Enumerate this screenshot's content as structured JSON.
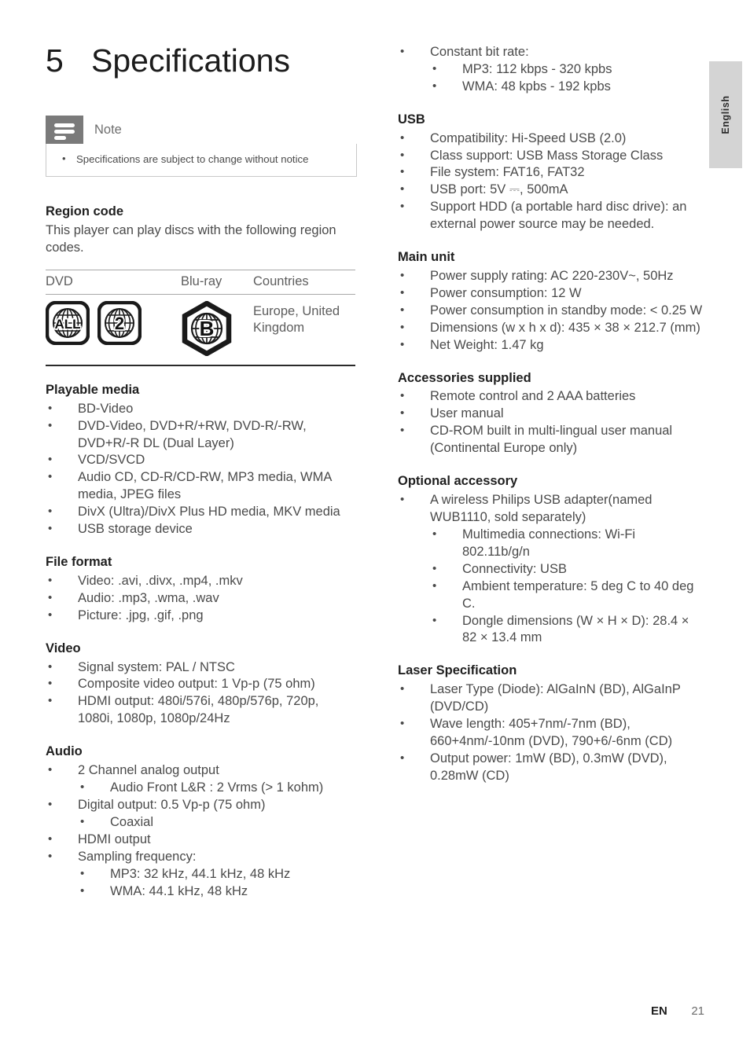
{
  "language_tab": {
    "label": "English"
  },
  "chapter": {
    "number": "5",
    "title": "Specifications"
  },
  "note": {
    "icon": "note-lines-icon",
    "title": "Note",
    "items": [
      "Specifications are subject to change without notice"
    ]
  },
  "region_code": {
    "heading": "Region code",
    "intro": "This player can play discs with the following region codes.",
    "table": {
      "columns": [
        "DVD",
        "Blu-ray",
        "Countries"
      ],
      "row": {
        "dvd_icons": [
          "ALL",
          "2"
        ],
        "bluray_icon": "B",
        "countries": "Europe, United Kingdom"
      }
    }
  },
  "left_sections": [
    {
      "heading": "Playable media",
      "items": [
        {
          "text": "BD-Video"
        },
        {
          "text": "DVD-Video, DVD+R/+RW, DVD-R/-RW, DVD+R/-R DL (Dual Layer)"
        },
        {
          "text": "VCD/SVCD"
        },
        {
          "text": "Audio CD, CD-R/CD-RW, MP3 media, WMA media, JPEG files"
        },
        {
          "text": "DivX (Ultra)/DivX Plus HD media, MKV media"
        },
        {
          "text": "USB storage device"
        }
      ]
    },
    {
      "heading": "File format",
      "items": [
        {
          "text": "Video: .avi, .divx, .mp4, .mkv"
        },
        {
          "text": "Audio: .mp3, .wma, .wav"
        },
        {
          "text": "Picture: .jpg, .gif, .png"
        }
      ]
    },
    {
      "heading": "Video",
      "items": [
        {
          "text": "Signal system: PAL / NTSC"
        },
        {
          "text": "Composite video output: 1 Vp-p (75 ohm)"
        },
        {
          "text": "HDMI output: 480i/576i, 480p/576p, 720p, 1080i, 1080p, 1080p/24Hz"
        }
      ]
    },
    {
      "heading": "Audio",
      "items": [
        {
          "text": "2 Channel analog output",
          "sub": [
            "Audio Front L&R : 2 Vrms (> 1 kohm)"
          ]
        },
        {
          "text": "Digital output: 0.5 Vp-p (75 ohm)",
          "sub": [
            "Coaxial"
          ]
        },
        {
          "text": "HDMI output"
        },
        {
          "text": "Sampling frequency:",
          "sub": [
            "MP3: 32 kHz, 44.1 kHz, 48 kHz",
            "WMA: 44.1 kHz, 48 kHz"
          ]
        }
      ]
    }
  ],
  "right_top": {
    "items": [
      {
        "text": "Constant bit rate:",
        "sub": [
          "MP3: 112 kbps - 320 kpbs",
          "WMA: 48 kpbs - 192 kpbs"
        ]
      }
    ]
  },
  "right_sections": [
    {
      "heading": "USB",
      "items": [
        {
          "text": "Compatibility: Hi-Speed USB (2.0)"
        },
        {
          "text": "Class support: USB Mass Storage Class"
        },
        {
          "text": "File system: FAT16, FAT32"
        },
        {
          "text": "USB port: 5V ⎓, 500mA"
        },
        {
          "text": "Support HDD (a portable hard disc drive): an external power source may be needed."
        }
      ]
    },
    {
      "heading": "Main unit",
      "items": [
        {
          "text": "Power supply rating: AC 220-230V~, 50Hz"
        },
        {
          "text": "Power consumption: 12 W"
        },
        {
          "text": "Power consumption in standby mode: < 0.25 W"
        },
        {
          "text": "Dimensions (w x h x d): 435 × 38 × 212.7 (mm)"
        },
        {
          "text": "Net Weight: 1.47 kg"
        }
      ]
    },
    {
      "heading": "Accessories supplied",
      "items": [
        {
          "text": "Remote control and 2 AAA batteries"
        },
        {
          "text": "User manual"
        },
        {
          "text": "CD-ROM built in multi-lingual user manual (Continental Europe only)"
        }
      ]
    },
    {
      "heading": "Optional accessory",
      "items": [
        {
          "text": "A wireless Philips USB adapter(named WUB1110, sold separately)",
          "sub": [
            "Multimedia connections: Wi-Fi 802.11b/g/n",
            "Connectivity: USB",
            "Ambient temperature: 5 deg C to 40 deg C.",
            "Dongle dimensions (W × H × D): 28.4 × 82 × 13.4 mm"
          ]
        }
      ]
    },
    {
      "heading": "Laser Specification",
      "items": [
        {
          "text": "Laser Type (Diode): AlGaInN (BD), AlGaInP (DVD/CD)"
        },
        {
          "text": "Wave length: 405+7nm/-7nm (BD), 660+4nm/-10nm (DVD), 790+6/-6nm (CD)"
        },
        {
          "text": "Output power: 1mW (BD), 0.3mW (DVD), 0.28mW (CD)"
        }
      ]
    }
  ],
  "footer": {
    "lang_code": "EN",
    "page_number": "21"
  },
  "colors": {
    "note_icon_bg": "#7a7a7a",
    "tab_bg": "#d4d4d4",
    "body_text": "#4a4a4a",
    "heading_text": "#1f1f1f",
    "rule_light": "#a8a8a8",
    "rule_dark": "#2a2a2a"
  }
}
